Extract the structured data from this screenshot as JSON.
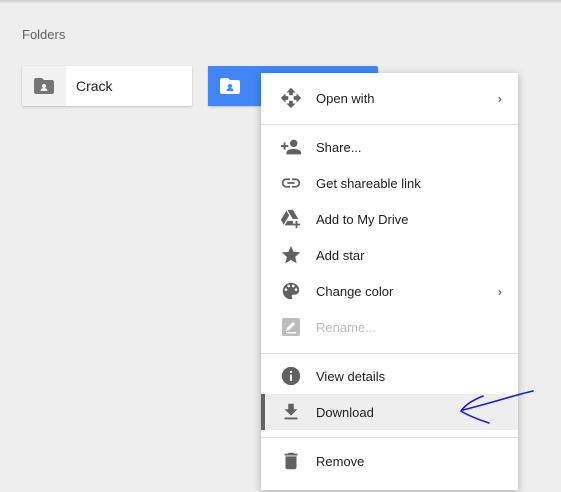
{
  "section": {
    "title": "Folders"
  },
  "folders": [
    {
      "name": "Crack",
      "selected": false
    },
    {
      "name": "",
      "selected": true
    }
  ],
  "menu": {
    "items": [
      {
        "label": "Open with",
        "icon": "open-with-icon",
        "has_submenu": true,
        "disabled": false
      },
      {
        "label": "Share...",
        "icon": "person-add-icon",
        "has_submenu": false,
        "disabled": false
      },
      {
        "label": "Get shareable link",
        "icon": "link-icon",
        "has_submenu": false,
        "disabled": false
      },
      {
        "label": "Add to My Drive",
        "icon": "drive-add-icon",
        "has_submenu": false,
        "disabled": false
      },
      {
        "label": "Add star",
        "icon": "star-icon",
        "has_submenu": false,
        "disabled": false
      },
      {
        "label": "Change color",
        "icon": "palette-icon",
        "has_submenu": true,
        "disabled": false
      },
      {
        "label": "Rename...",
        "icon": "rename-icon",
        "has_submenu": false,
        "disabled": true
      },
      {
        "label": "View details",
        "icon": "info-icon",
        "has_submenu": false,
        "disabled": false
      },
      {
        "label": "Download",
        "icon": "download-icon",
        "has_submenu": false,
        "disabled": false,
        "highlighted": true
      },
      {
        "label": "Remove",
        "icon": "trash-icon",
        "has_submenu": false,
        "disabled": false
      }
    ],
    "submenu_chevron": "›"
  },
  "colors": {
    "background": "#eeeeee",
    "selected_folder": "#4285f4",
    "icon": "#616161",
    "annotation": "#1a1adc"
  }
}
